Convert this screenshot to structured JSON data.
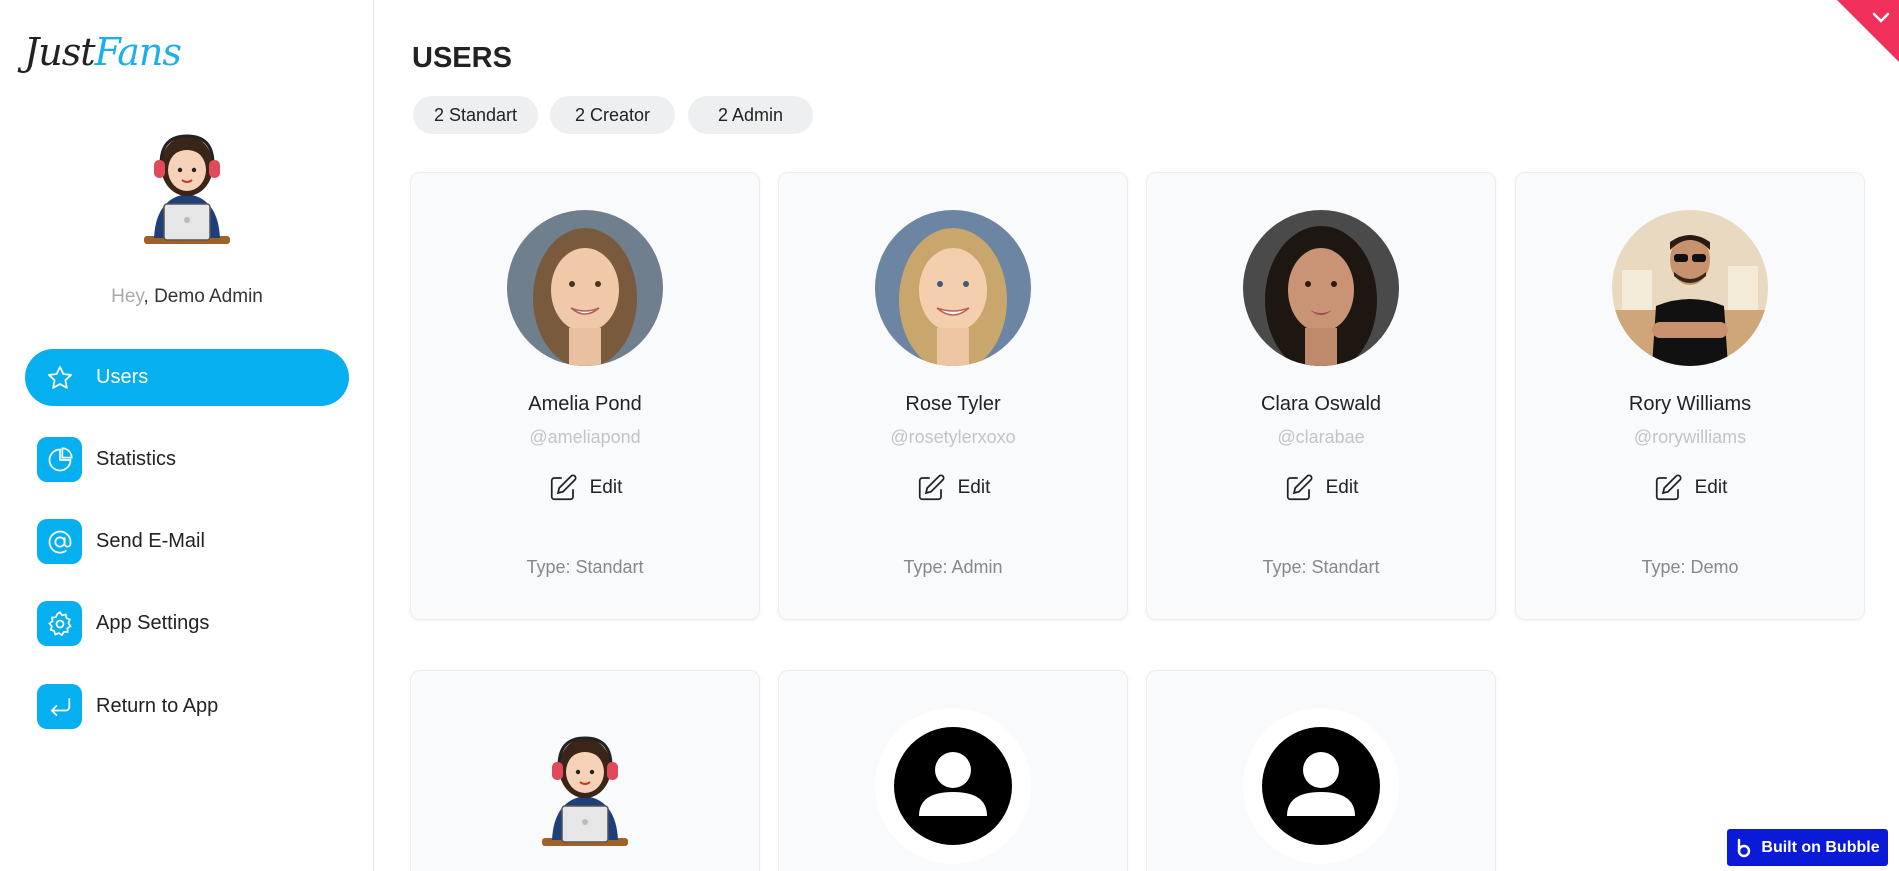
{
  "brand": {
    "part1": "Just",
    "part2": "Fans",
    "accent": "#05aff0"
  },
  "greeting": {
    "prefix": "Hey",
    "name": ", Demo Admin"
  },
  "nav": [
    {
      "label": "Users",
      "icon": "star-icon",
      "active": true
    },
    {
      "label": "Statistics",
      "icon": "pie-chart-icon"
    },
    {
      "label": "Send E-Mail",
      "icon": "at-sign-icon"
    },
    {
      "label": "App Settings",
      "icon": "gear-icon"
    },
    {
      "label": "Return to App",
      "icon": "return-arrow-icon"
    }
  ],
  "page_title": "USERS",
  "filters": [
    "2 Standart",
    "2 Creator",
    "2 Admin"
  ],
  "users": [
    {
      "name": "Amelia Pond",
      "handle": "@ameliapond",
      "edit": "Edit",
      "type": "Type: Standart"
    },
    {
      "name": "Rose Tyler",
      "handle": "@rosetylerxoxo",
      "edit": "Edit",
      "type": "Type: Admin"
    },
    {
      "name": "Clara Oswald",
      "handle": "@clarabae",
      "edit": "Edit",
      "type": "Type: Standart"
    },
    {
      "name": "Rory Williams",
      "handle": "@rorywilliams",
      "edit": "Edit",
      "type": "Type: Demo"
    }
  ],
  "built_on": "Built on Bubble"
}
